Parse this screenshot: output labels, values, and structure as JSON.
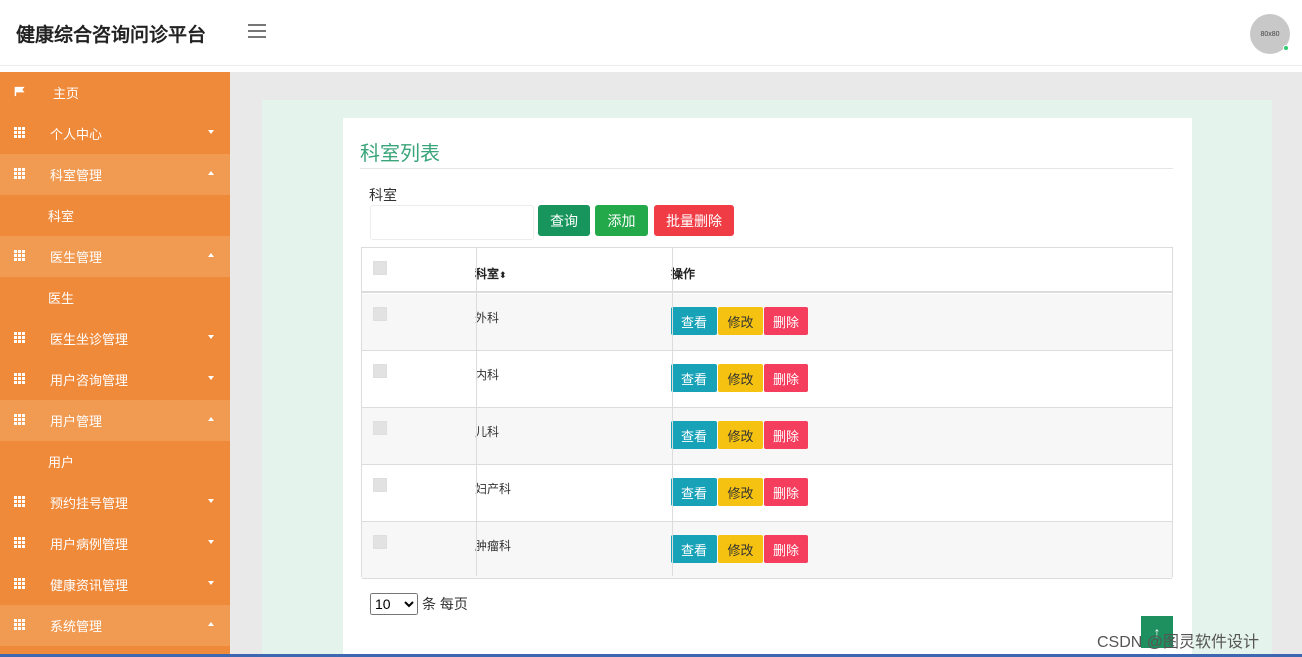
{
  "header": {
    "brand": "健康综合咨询问诊平台",
    "avatar_text": "80x80"
  },
  "sidebar": {
    "items": [
      {
        "label": "主页",
        "icon": "flag-icon",
        "type": "item"
      },
      {
        "label": "个人中心",
        "icon": "grid-icon",
        "type": "item"
      },
      {
        "label": "科室管理",
        "icon": "grid-icon",
        "type": "item",
        "open": true
      },
      {
        "label": "科室",
        "type": "sub"
      },
      {
        "label": "医生管理",
        "icon": "grid-icon",
        "type": "item",
        "open": true
      },
      {
        "label": "医生",
        "type": "sub"
      },
      {
        "label": "医生坐诊管理",
        "icon": "grid-icon",
        "type": "item"
      },
      {
        "label": "用户咨询管理",
        "icon": "grid-icon",
        "type": "item"
      },
      {
        "label": "用户管理",
        "icon": "grid-icon",
        "type": "item",
        "open": true
      },
      {
        "label": "用户",
        "type": "sub"
      },
      {
        "label": "预约挂号管理",
        "icon": "grid-icon",
        "type": "item"
      },
      {
        "label": "用户病例管理",
        "icon": "grid-icon",
        "type": "item"
      },
      {
        "label": "健康资讯管理",
        "icon": "grid-icon",
        "type": "item"
      },
      {
        "label": "系统管理",
        "icon": "grid-icon",
        "type": "item",
        "open": true
      }
    ]
  },
  "main": {
    "title": "科室列表",
    "search_label": "科室",
    "search_value": "",
    "buttons": {
      "query": "查询",
      "add": "添加",
      "batch_delete": "批量删除"
    },
    "table": {
      "columns": [
        "科室",
        "操作"
      ],
      "sort_icon": "⬍",
      "rows": [
        "外科",
        "内科",
        "儿科",
        "妇产科",
        "肿瘤科"
      ],
      "actions": {
        "view": "查看",
        "edit": "修改",
        "delete": "删除"
      }
    },
    "pager": {
      "page_size": "10",
      "options": [
        "10"
      ],
      "suffix": "条 每页"
    }
  },
  "watermark": "CSDN @图灵软件设计",
  "colors": {
    "sidebar": "#ef8a3b",
    "accent": "#3aa57a",
    "query": "#17955c",
    "add": "#23a84a",
    "danger": "#f03c45",
    "view": "#17a2b8",
    "edit": "#f5c211"
  }
}
